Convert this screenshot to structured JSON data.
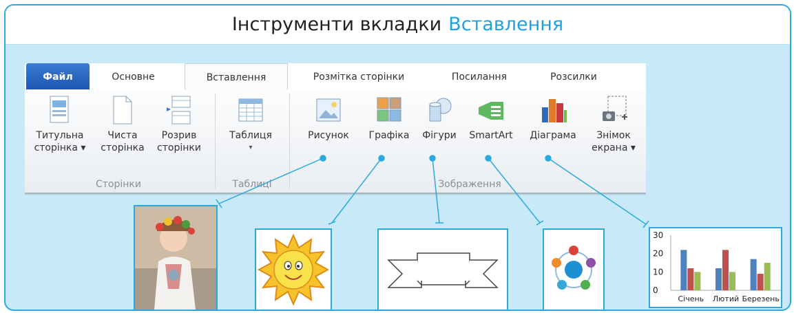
{
  "title": {
    "prefix": "Інструменти вкладки",
    "accent": "Вставлення"
  },
  "tabs": [
    "Файл",
    "Основне",
    "Вставлення",
    "Розмітка сторінки",
    "Посилання",
    "Розсилки"
  ],
  "commands": {
    "cover_page": {
      "line1": "Титульна",
      "line2": "сторінка ▾"
    },
    "blank_page": {
      "line1": "Чиста",
      "line2": "сторінка"
    },
    "page_break": {
      "line1": "Розрив",
      "line2": "сторінки"
    },
    "table": {
      "line1": "Таблиця",
      "line2": "▾"
    },
    "picture": {
      "line1": "Рисунок"
    },
    "clipart": {
      "line1": "Графіка"
    },
    "shapes": {
      "line1": "Фігури"
    },
    "smartart": {
      "line1": "SmartArt"
    },
    "chart": {
      "line1": "Діаграма"
    },
    "screenshot": {
      "line1": "Знімок",
      "line2": "екрана ▾"
    }
  },
  "groups": [
    "Сторінки",
    "Таблиці",
    "Зображення"
  ],
  "chart_data": {
    "type": "bar",
    "categories": [
      "Січень",
      "Лютий",
      "Березень"
    ],
    "series": [
      {
        "values": [
          22,
          12,
          17
        ],
        "color": "#4f81bd"
      },
      {
        "values": [
          12,
          22,
          9
        ],
        "color": "#c0504d"
      },
      {
        "values": [
          10,
          10,
          15
        ],
        "color": "#9bbb59"
      }
    ],
    "yticks": [
      "30",
      "20",
      "10",
      "0"
    ],
    "ylim": [
      0,
      30
    ]
  },
  "colors": {
    "accent": "#1aa3e0",
    "frame_bg": "#c8e9f8",
    "connector": "#29a9e0"
  }
}
